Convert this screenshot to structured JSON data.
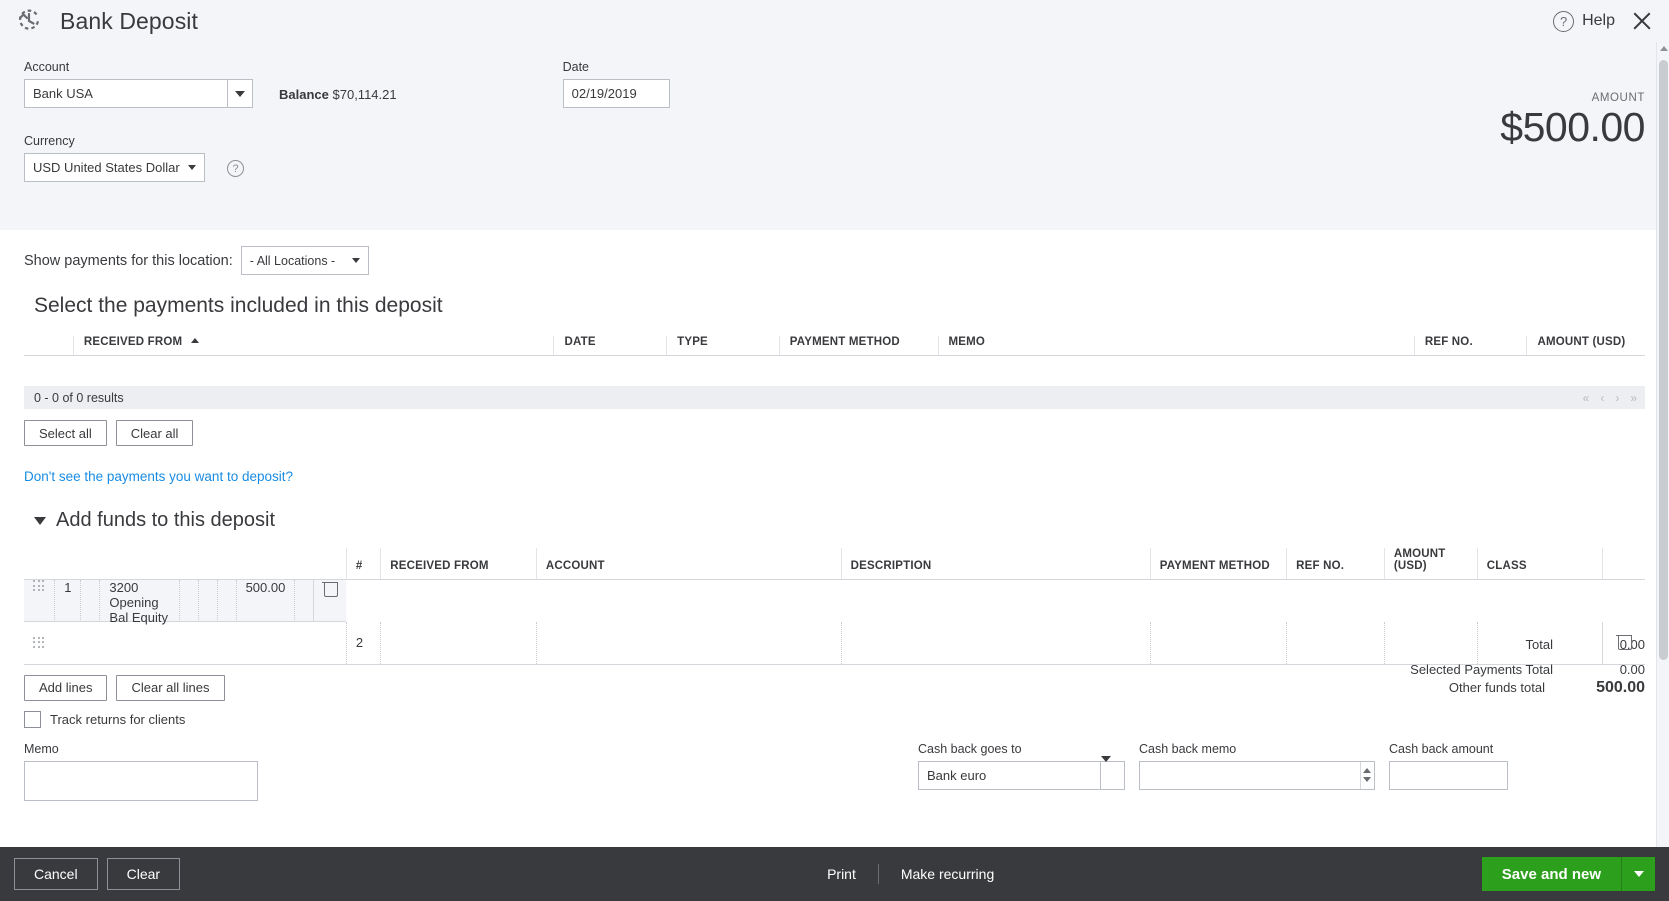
{
  "header": {
    "title": "Bank Deposit",
    "logo_icon": "quickbooks-recurring-icon",
    "help_label": "Help",
    "help_icon": "question-circle-icon",
    "close_icon": "close-icon"
  },
  "form": {
    "account_label": "Account",
    "account_value": "Bank USA",
    "balance_prefix": "Balance",
    "balance_value": "$70,114.21",
    "date_label": "Date",
    "date_value": "02/19/2019",
    "currency_label": "Currency",
    "currency_value": "USD United States Dollar",
    "currency_help_icon": "question-circle-icon",
    "amount_label": "AMOUNT",
    "amount_value": "$500.00"
  },
  "location": {
    "label": "Show payments for this location:",
    "value": "- All Locations -"
  },
  "payments": {
    "section_title": "Select the payments included in this deposit",
    "columns": [
      "RECEIVED FROM",
      "DATE",
      "TYPE",
      "PAYMENT METHOD",
      "MEMO",
      "REF NO.",
      "AMOUNT (USD)"
    ],
    "sort_column": "RECEIVED FROM",
    "sort_direction": "ascending",
    "rows": [],
    "results_text": "0 - 0 of 0 results",
    "pager": {
      "first": "«",
      "prev": "‹",
      "next": "›",
      "last": "»"
    },
    "select_all_label": "Select all",
    "clear_all_label": "Clear all",
    "total_label": "Total",
    "total_value": "0.00",
    "selected_total_label": "Selected Payments Total",
    "selected_total_value": "0.00",
    "help_link": "Don't see the payments you want to deposit?"
  },
  "funds": {
    "title": "Add funds to this deposit",
    "expanded": true,
    "columns": [
      "#",
      "RECEIVED FROM",
      "ACCOUNT",
      "DESCRIPTION",
      "PAYMENT METHOD",
      "REF NO.",
      "AMOUNT (USD)",
      "CLASS"
    ],
    "rows": [
      {
        "num": "1",
        "received_from": "",
        "account": "3200 Opening Bal Equity",
        "description": "",
        "payment_method": "",
        "ref_no": "",
        "amount": "500.00",
        "class": ""
      },
      {
        "num": "2",
        "received_from": "",
        "account": "",
        "description": "",
        "payment_method": "",
        "ref_no": "",
        "amount": "",
        "class": ""
      }
    ],
    "add_lines_label": "Add lines",
    "clear_all_lines_label": "Clear all lines",
    "other_funds_label": "Other funds total",
    "other_funds_value": "500.00",
    "track_returns_label": "Track returns for clients",
    "track_returns_checked": false
  },
  "bottom": {
    "memo_label": "Memo",
    "memo_value": "",
    "cash_back_goes_to_label": "Cash back goes to",
    "cash_back_goes_to_value": "Bank euro",
    "cash_back_memo_label": "Cash back memo",
    "cash_back_memo_value": "",
    "cash_back_amount_label": "Cash back amount",
    "cash_back_amount_value": ""
  },
  "footer": {
    "cancel_label": "Cancel",
    "clear_label": "Clear",
    "print_label": "Print",
    "make_recurring_label": "Make recurring",
    "save_label": "Save and new"
  },
  "colors": {
    "accent_green": "#2ca01c",
    "link_blue": "#1a8ce3",
    "panel_grey": "#f4f5f8",
    "footer_dark": "#393a3d"
  }
}
